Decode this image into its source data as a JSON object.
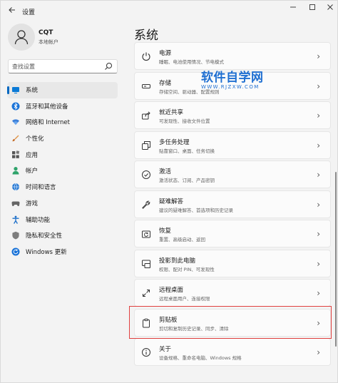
{
  "window": {
    "title": "设置"
  },
  "profile": {
    "name": "CQT",
    "subtitle": "本地帐户"
  },
  "search": {
    "placeholder": "查找设置"
  },
  "nav": [
    {
      "label": "系统",
      "icon": "monitor-icon",
      "active": true
    },
    {
      "label": "蓝牙和其他设备",
      "icon": "bluetooth-icon"
    },
    {
      "label": "网络和 Internet",
      "icon": "wifi-icon"
    },
    {
      "label": "个性化",
      "icon": "paintbrush-icon"
    },
    {
      "label": "应用",
      "icon": "apps-icon"
    },
    {
      "label": "帐户",
      "icon": "person-icon"
    },
    {
      "label": "时间和语言",
      "icon": "globe-clock-icon"
    },
    {
      "label": "游戏",
      "icon": "gamepad-icon"
    },
    {
      "label": "辅助功能",
      "icon": "accessibility-icon"
    },
    {
      "label": "隐私和安全性",
      "icon": "shield-icon"
    },
    {
      "label": "Windows 更新",
      "icon": "update-icon"
    }
  ],
  "page": {
    "title": "系统"
  },
  "cards": [
    {
      "title": "电源",
      "desc": "睡眠、电池使用情况、节电模式",
      "icon": "power-icon"
    },
    {
      "title": "存储",
      "desc": "存储空间、驱动器、配置规则",
      "icon": "storage-icon"
    },
    {
      "title": "就近共享",
      "desc": "可发现性、接收文件位置",
      "icon": "nearby-share-icon"
    },
    {
      "title": "多任务处理",
      "desc": "贴靠窗口、桌面、任务切换",
      "icon": "multitasking-icon"
    },
    {
      "title": "激活",
      "desc": "激活状态、订阅、产品密钥",
      "icon": "activation-icon"
    },
    {
      "title": "疑难解答",
      "desc": "建议的疑难解答、首选项和历史记录",
      "icon": "wrench-icon"
    },
    {
      "title": "恢复",
      "desc": "重置、高级启动、返回",
      "icon": "recovery-icon"
    },
    {
      "title": "投影到此电脑",
      "desc": "权限、配对 PIN、可发现性",
      "icon": "project-icon"
    },
    {
      "title": "远程桌面",
      "desc": "远程桌面用户、连接权限",
      "icon": "remote-desktop-icon"
    },
    {
      "title": "剪贴板",
      "desc": "剪切和复制历史记录、同步、清除",
      "icon": "clipboard-icon"
    },
    {
      "title": "关于",
      "desc": "设备规格、重命名电脑、Windows 规格",
      "icon": "info-icon"
    }
  ],
  "watermark": {
    "main": "软件自学网",
    "sub": "WWW.RJZXW.COM"
  },
  "colors": {
    "accent": "#0067c0",
    "highlight": "#e0403f",
    "watermark": "#1f6fd1"
  }
}
